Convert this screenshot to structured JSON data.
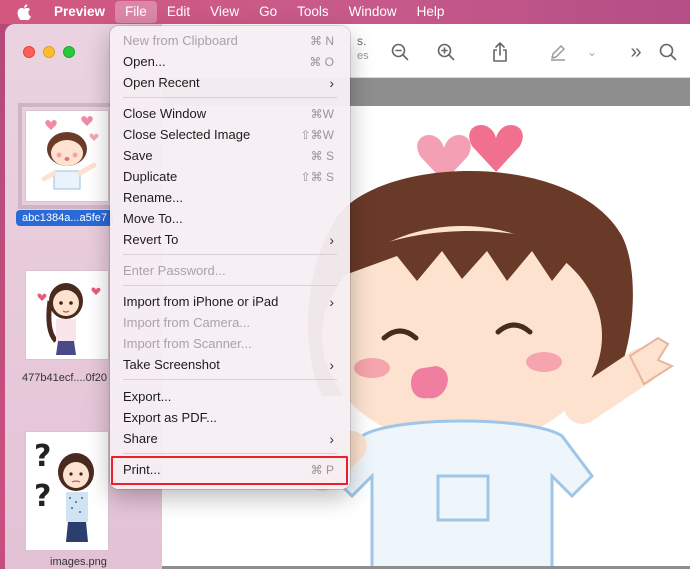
{
  "menubar": {
    "app_name": "Preview",
    "items": [
      "File",
      "Edit",
      "View",
      "Go",
      "Tools",
      "Window",
      "Help"
    ]
  },
  "sidebar": {
    "thumbnails": [
      {
        "label": "abc1384a...a5fe7",
        "selected": true
      },
      {
        "label": "477b41ecf....0f20",
        "selected": false
      },
      {
        "label": "images.png",
        "selected": false
      }
    ]
  },
  "toolbar": {
    "partial_title": "s.",
    "partial_subtitle": "es"
  },
  "file_menu": {
    "new_from_clipboard": {
      "label": "New from Clipboard",
      "shortcut": "⌘ N"
    },
    "open": {
      "label": "Open...",
      "shortcut": "⌘ O"
    },
    "open_recent": {
      "label": "Open Recent"
    },
    "close_window": {
      "label": "Close Window",
      "shortcut": "⌘W"
    },
    "close_selected_image": {
      "label": "Close Selected Image",
      "shortcut": "⇧⌘W"
    },
    "save": {
      "label": "Save",
      "shortcut": "⌘ S"
    },
    "duplicate": {
      "label": "Duplicate",
      "shortcut": "⇧⌘ S"
    },
    "rename": {
      "label": "Rename..."
    },
    "move_to": {
      "label": "Move To..."
    },
    "revert_to": {
      "label": "Revert To"
    },
    "enter_password": {
      "label": "Enter Password..."
    },
    "import_iphone": {
      "label": "Import from iPhone or iPad"
    },
    "import_camera": {
      "label": "Import from Camera..."
    },
    "import_scanner": {
      "label": "Import from Scanner..."
    },
    "take_screenshot": {
      "label": "Take Screenshot"
    },
    "export": {
      "label": "Export..."
    },
    "export_pdf": {
      "label": "Export as PDF..."
    },
    "share": {
      "label": "Share"
    },
    "print": {
      "label": "Print...",
      "shortcut": "⌘ P"
    }
  },
  "colors": {
    "highlight_box": "#e8212b",
    "selection_blue": "#2a6ad6"
  }
}
